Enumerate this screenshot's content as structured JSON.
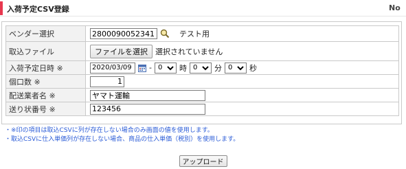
{
  "header": {
    "title": "入荷予定CSV登録",
    "no_label": "No"
  },
  "form": {
    "vendor": {
      "label": "ベンダー選択",
      "code_value": "2800090052341",
      "vendor_name": "テスト用"
    },
    "file": {
      "label": "取込ファイル",
      "button_label": "ファイルを選択",
      "status": "選択されていません"
    },
    "scheduled_date": {
      "label": "入荷予定日時 ※",
      "date_value": "2020/03/09",
      "separator": "-",
      "hour_value": "0",
      "hour_unit": "時",
      "minute_value": "0",
      "minute_unit": "分",
      "second_value": "0",
      "second_unit": "秒"
    },
    "package_count": {
      "label": "個口数 ※",
      "value": "1"
    },
    "carrier": {
      "label": "配送業者名 ※",
      "value": "ヤマト運輸"
    },
    "tracking": {
      "label": "送り状番号 ※",
      "value": "123456"
    }
  },
  "notes": [
    "・※印の項目は取込CSVに列が存在しない場合のみ画面の値を使用します。",
    "・取込CSVに仕入単価列が存在しない場合、商品の仕入単価（税別）を使用します。"
  ],
  "actions": {
    "upload_label": "アップロード"
  },
  "colors": {
    "accent": "#e8384f",
    "note_text": "#2a5bd7",
    "label_bg": "#f2f2f2",
    "border": "#c9c9c9"
  },
  "icons": {
    "vendor_search": "magnifier-icon",
    "date_picker": "calendar-icon"
  }
}
